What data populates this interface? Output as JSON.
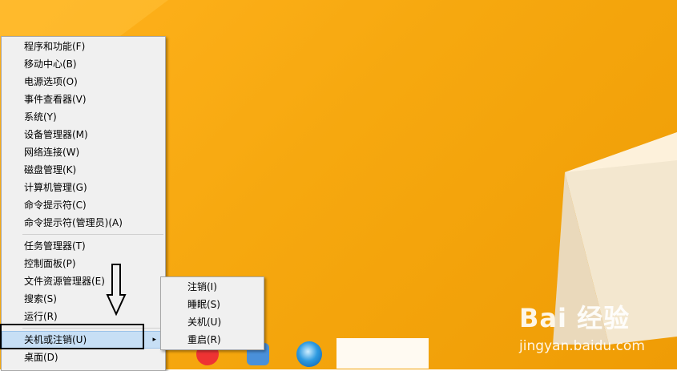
{
  "menu": {
    "group1": [
      "程序和功能(F)",
      "移动中心(B)",
      "电源选项(O)",
      "事件查看器(V)",
      "系统(Y)",
      "设备管理器(M)",
      "网络连接(W)",
      "磁盘管理(K)",
      "计算机管理(G)",
      "命令提示符(C)",
      "命令提示符(管理员)(A)"
    ],
    "group2": [
      "任务管理器(T)",
      "控制面板(P)",
      "文件资源管理器(E)",
      "搜索(S)",
      "运行(R)"
    ],
    "shutdown_label": "关机或注销(U)",
    "desktop_label": "桌面(D)",
    "submenu_arrow": "▸"
  },
  "submenu": {
    "items": [
      "注销(I)",
      "睡眠(S)",
      "关机(U)",
      "重启(R)"
    ]
  },
  "watermark": {
    "logo": "Bai 经验",
    "url": "jingyan.baidu.com"
  },
  "colors": {
    "desktop": "#f6a80f",
    "menu_bg": "#f0f0f0",
    "selected_bg": "#c7dff5"
  },
  "annotation": {
    "arrow_icon": "down-arrow-icon"
  }
}
